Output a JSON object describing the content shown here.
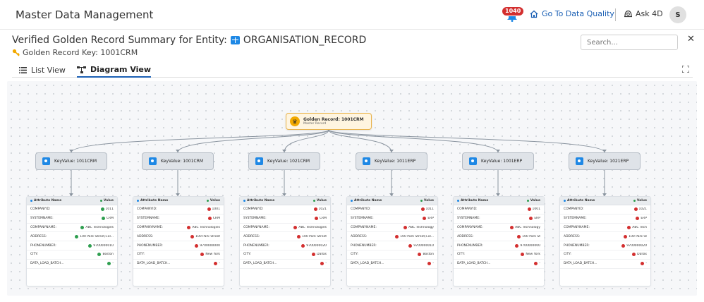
{
  "header": {
    "app_title": "Master Data Management",
    "notification_count": "1040",
    "go_to_label": "Go To Data Quality",
    "ask_label": "Ask 4D",
    "avatar_initial": "S"
  },
  "summary": {
    "title_prefix": "Verified Golden Record Summary for Entity:",
    "entity": "ORGANISATION_RECORD",
    "key_label": "Golden Record Key: 1001CRM"
  },
  "search": {
    "placeholder": "Search..."
  },
  "tabs": [
    {
      "label": "List View"
    },
    {
      "label": "Diagram View"
    }
  ],
  "diagram": {
    "golden": {
      "title": "Golden Record: 1001CRM",
      "subtitle": "Master Record"
    },
    "table_headers": {
      "attribute": "Attribute Name",
      "value": "Value"
    },
    "attributes": [
      "COMPANYID:",
      "SYSTEMNAME:",
      "COMPANYNAME:",
      "ADDRESS:",
      "PHONENUMBER:",
      "CITY:",
      "DATA_LOAD_BATCH..."
    ],
    "sources": [
      {
        "key": "KeyValue: 1011CRM",
        "values": [
          {
            "v": "1011",
            "s": "ok"
          },
          {
            "v": "CRM",
            "s": "ok"
          },
          {
            "v": "ABC Technologies",
            "s": "ok"
          },
          {
            "v": "100 Park Street,Col...",
            "s": "ok"
          },
          {
            "v": "9700000010",
            "s": "ok"
          },
          {
            "v": "Boston",
            "s": "ok"
          },
          {
            "v": "-",
            "s": "ok"
          }
        ]
      },
      {
        "key": "KeyValue: 1001CRM",
        "values": [
          {
            "v": "1001",
            "s": "bad"
          },
          {
            "v": "CRM",
            "s": "bad"
          },
          {
            "v": "ABC Technologies",
            "s": "bad"
          },
          {
            "v": "100 Park Street",
            "s": "bad"
          },
          {
            "v": "9700000000",
            "s": "bad"
          },
          {
            "v": "New York",
            "s": "bad"
          },
          {
            "v": "-",
            "s": "bad"
          }
        ]
      },
      {
        "key": "KeyValue: 1021CRM",
        "values": [
          {
            "v": "1021",
            "s": "bad"
          },
          {
            "v": "CRM",
            "s": "bad"
          },
          {
            "v": "ABC Technologies",
            "s": "bad"
          },
          {
            "v": "100 Park Street",
            "s": "bad"
          },
          {
            "v": "9700000020",
            "s": "bad"
          },
          {
            "v": "Dallas",
            "s": "bad"
          },
          {
            "v": "-",
            "s": "bad"
          }
        ]
      },
      {
        "key": "KeyValue: 1011ERP",
        "values": [
          {
            "v": "1011",
            "s": "bad"
          },
          {
            "v": "ERP",
            "s": "bad"
          },
          {
            "v": "ABC Technology",
            "s": "bad"
          },
          {
            "v": "100 Park Street,Col...",
            "s": "bad"
          },
          {
            "v": "9700000010",
            "s": "bad"
          },
          {
            "v": "Boston",
            "s": "bad"
          },
          {
            "v": "-",
            "s": "bad"
          }
        ]
      },
      {
        "key": "KeyValue: 1001ERP",
        "values": [
          {
            "v": "1001",
            "s": "bad"
          },
          {
            "v": "ERP",
            "s": "bad"
          },
          {
            "v": "ABC Technology",
            "s": "bad"
          },
          {
            "v": "100 Park St",
            "s": "bad"
          },
          {
            "v": "9700000000",
            "s": "bad"
          },
          {
            "v": "New York",
            "s": "bad"
          },
          {
            "v": "-",
            "s": "bad"
          }
        ]
      },
      {
        "key": "KeyValue: 1021ERP",
        "values": [
          {
            "v": "1021",
            "s": "bad"
          },
          {
            "v": "ERP",
            "s": "bad"
          },
          {
            "v": "ABC Tech",
            "s": "bad"
          },
          {
            "v": "100 Park St",
            "s": "bad"
          },
          {
            "v": "9700000020",
            "s": "bad"
          },
          {
            "v": "Dallas",
            "s": "bad"
          },
          {
            "v": "-",
            "s": "bad"
          }
        ]
      }
    ]
  },
  "colors": {
    "accent": "#1a5fb4",
    "ok": "#2e9e4f",
    "bad": "#d32f2f",
    "golden_bg": "#fff5e0"
  }
}
